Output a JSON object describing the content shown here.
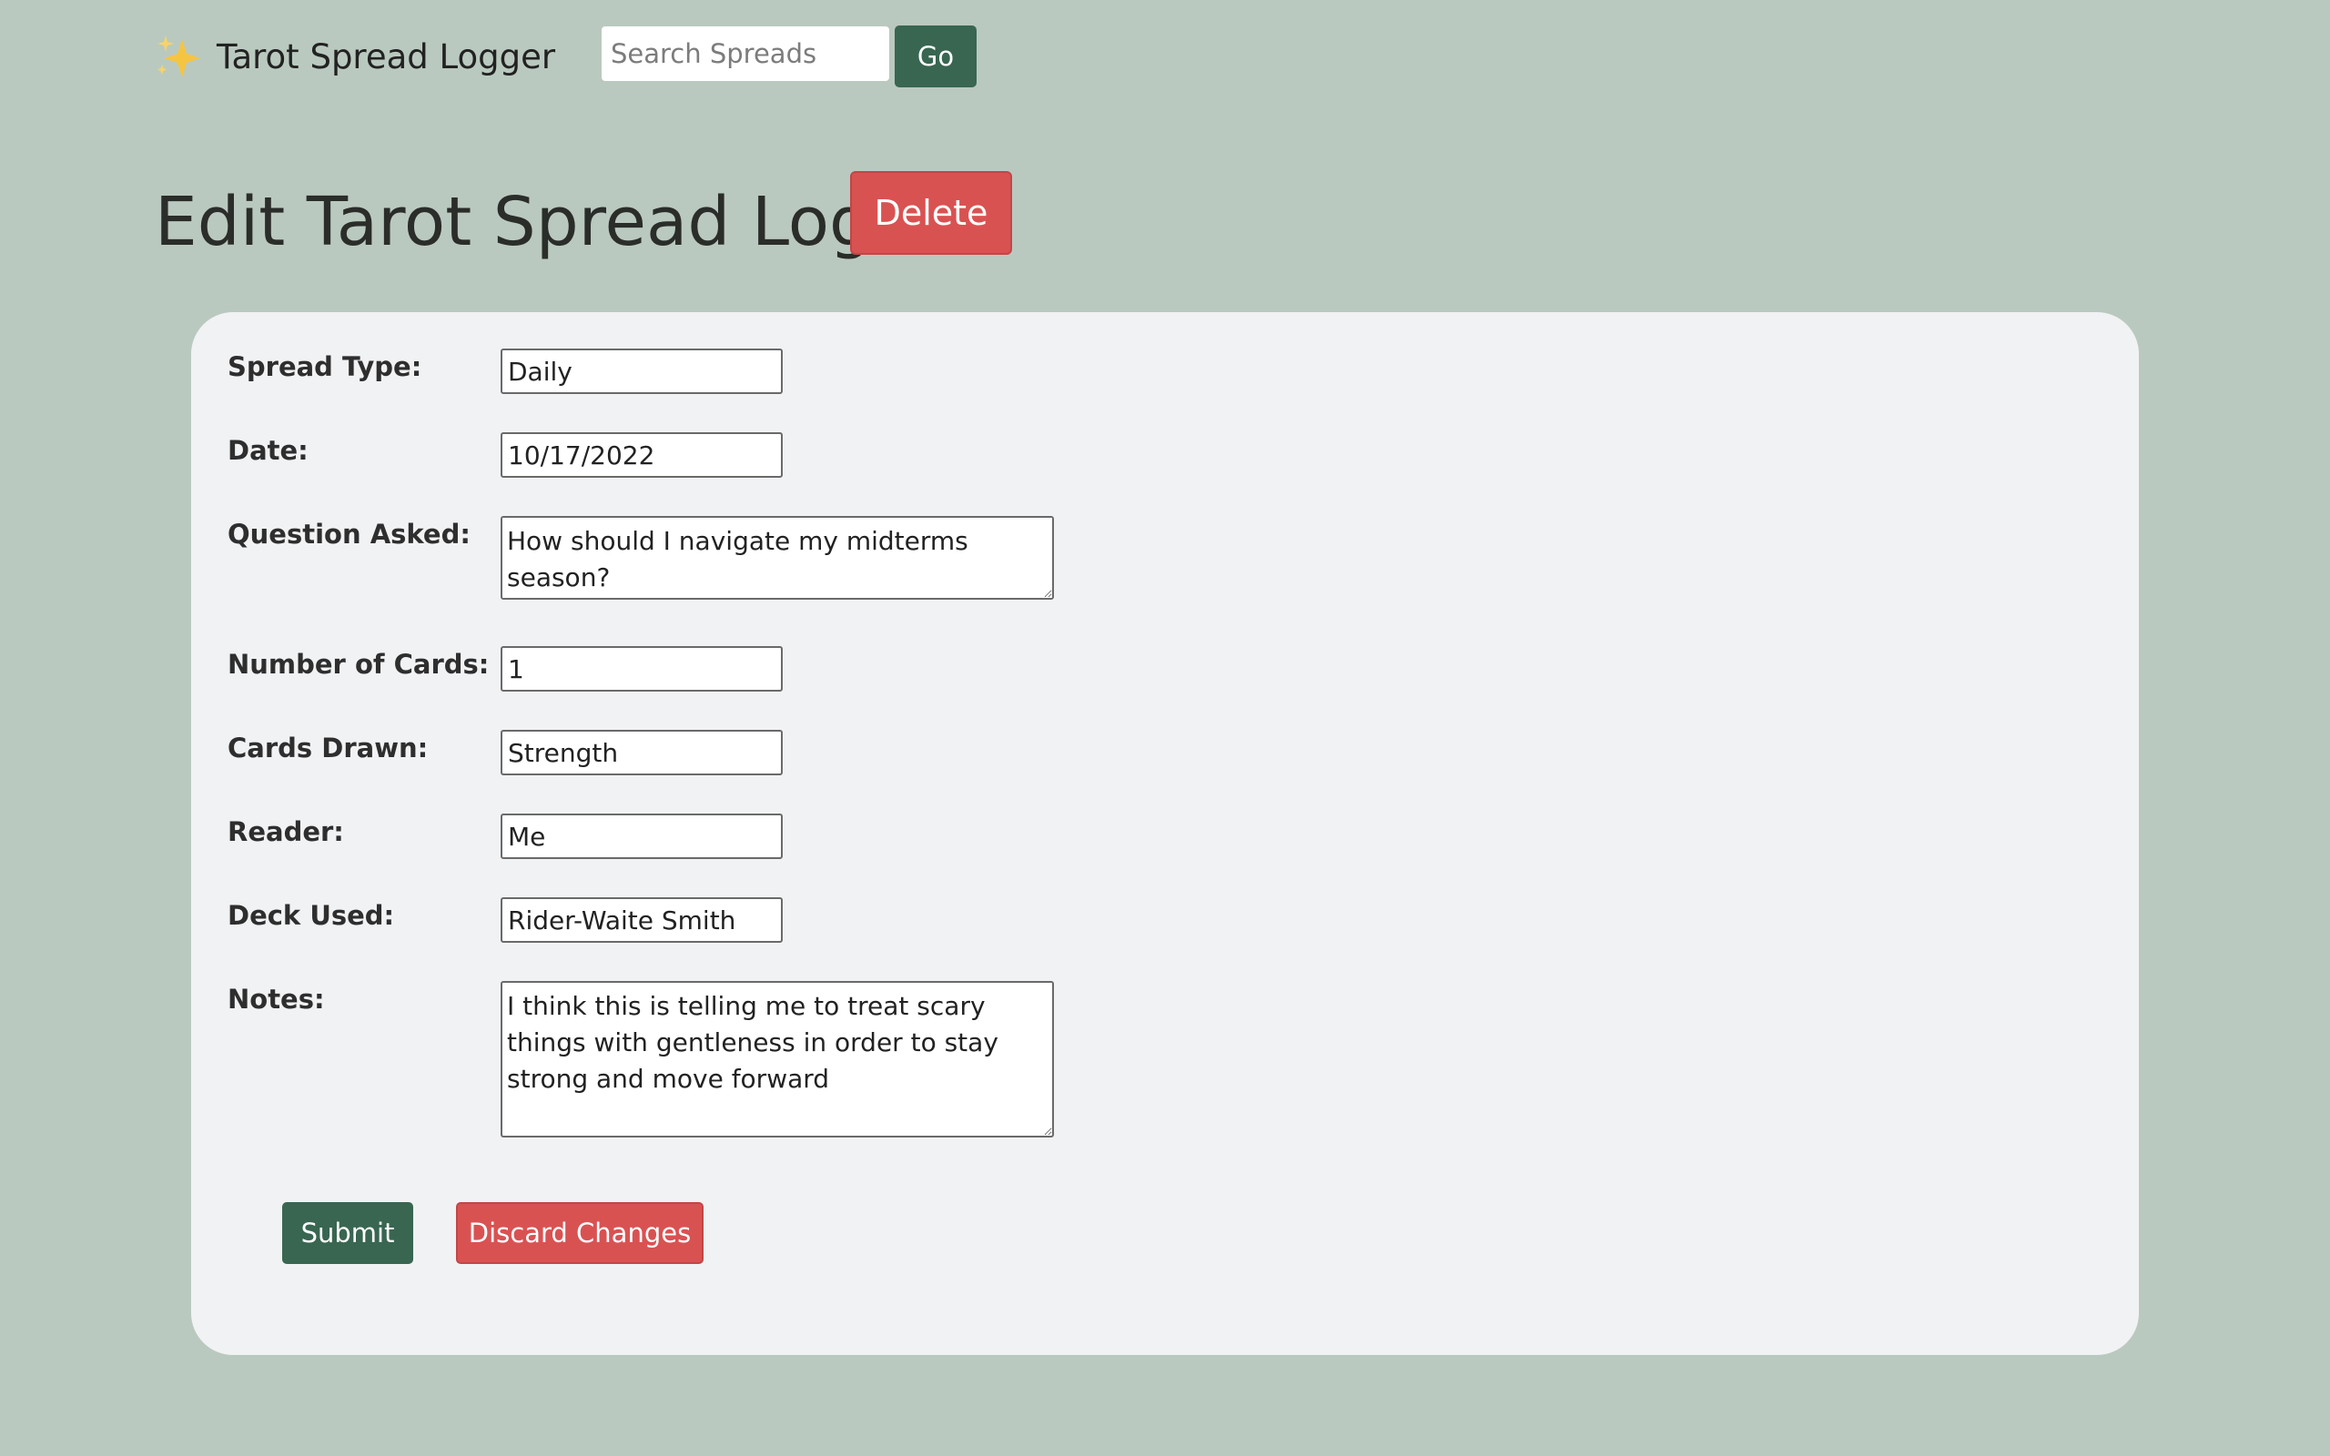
{
  "navbar": {
    "brand_icon": "sparkles-icon",
    "brand_title": "Tarot Spread Logger",
    "search_placeholder": "Search Spreads",
    "go_label": "Go"
  },
  "page": {
    "title": "Edit Tarot Spread Log",
    "delete_label": "Delete"
  },
  "form": {
    "spread_type": {
      "label": "Spread Type:",
      "value": "Daily"
    },
    "date": {
      "label": "Date:",
      "value": "10/17/2022"
    },
    "question": {
      "label": "Question Asked:",
      "value": "How should I navigate my midterms season?"
    },
    "num_cards": {
      "label": "Number of Cards:",
      "value": "1"
    },
    "cards_drawn": {
      "label": "Cards Drawn:",
      "value": "Strength"
    },
    "reader": {
      "label": "Reader:",
      "value": "Me"
    },
    "deck": {
      "label": "Deck Used:",
      "value": "Rider-Waite Smith"
    },
    "notes": {
      "label": "Notes:",
      "value": "I think this is telling me to treat scary things with gentleness in order to stay strong and move forward"
    },
    "submit_label": "Submit",
    "discard_label": "Discard Changes"
  },
  "colors": {
    "background": "#bac9bf",
    "primary_green": "#386651",
    "danger_red": "#d95252",
    "card_bg": "#f1f2f4",
    "sparkle_gold": "#f5c542"
  }
}
